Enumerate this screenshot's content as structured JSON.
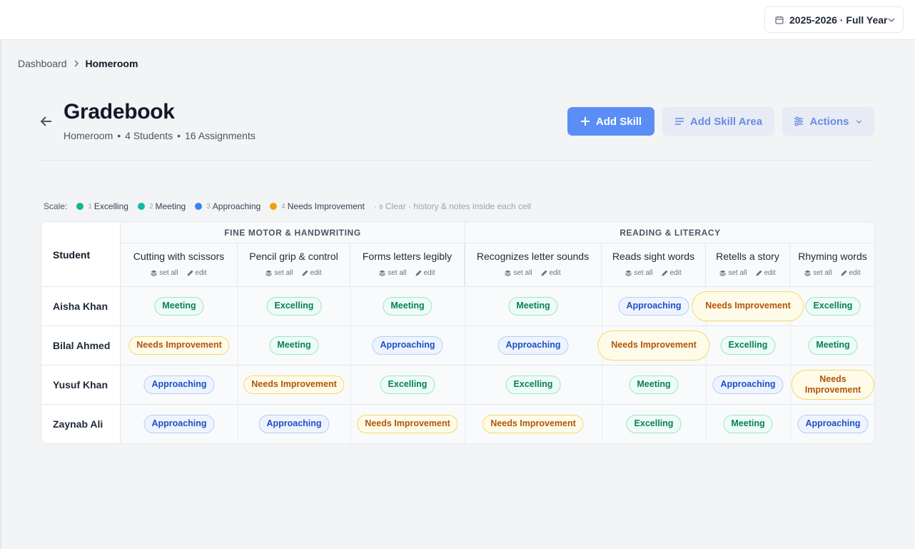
{
  "header": {
    "year_label": "2025-2026 · Full Year"
  },
  "breadcrumb": {
    "parent": "Dashboard",
    "current": "Homeroom"
  },
  "page": {
    "title": "Gradebook",
    "subtitle_class": "Homeroom",
    "subtitle_students": "4 Students",
    "subtitle_assignments": "16 Assignments",
    "separator": "•"
  },
  "toolbar": {
    "add_skill": "Add Skill",
    "add_skill_area": "Add Skill Area",
    "actions": "Actions"
  },
  "scale": {
    "label": "Scale:",
    "items": [
      {
        "num": "1",
        "label": "Excelling",
        "color": "#10b981"
      },
      {
        "num": "2",
        "label": "Meeting",
        "color": "#14b8a6"
      },
      {
        "num": "3",
        "label": "Approaching",
        "color": "#3b82f6"
      },
      {
        "num": "4",
        "label": "Needs Improvement",
        "color": "#f59e0b"
      }
    ],
    "note_prefix": "·",
    "note_key": "0",
    "note_text": "Clear · history & notes inside each cell"
  },
  "grid": {
    "student_header": "Student",
    "set_all": "set all",
    "edit": "edit",
    "areas": [
      {
        "name": "FINE MOTOR & HANDWRITING"
      },
      {
        "name": "READING & LITERACY"
      }
    ],
    "skills": [
      "Cutting with scissors",
      "Pencil grip & control",
      "Forms letters legibly",
      "Recognizes letter sounds",
      "Reads sight words",
      "Retells a story",
      "Rhyming words"
    ],
    "students": [
      "Aisha Khan",
      "Bilal Ahmed",
      "Yusuf Khan",
      "Zaynab Ali"
    ],
    "grades": [
      [
        "Meeting",
        "Excelling",
        "Meeting",
        "Meeting",
        "Approaching",
        "Needs Improvement",
        "Excelling"
      ],
      [
        "Needs Improvement",
        "Meeting",
        "Approaching",
        "Approaching",
        "Needs Improvement",
        "Excelling",
        "Meeting"
      ],
      [
        "Approaching",
        "Needs Improvement",
        "Excelling",
        "Excelling",
        "Meeting",
        "Approaching",
        "Needs Improvement"
      ],
      [
        "Approaching",
        "Approaching",
        "Needs Improvement",
        "Needs Improvement",
        "Excelling",
        "Meeting",
        "Approaching"
      ]
    ]
  }
}
